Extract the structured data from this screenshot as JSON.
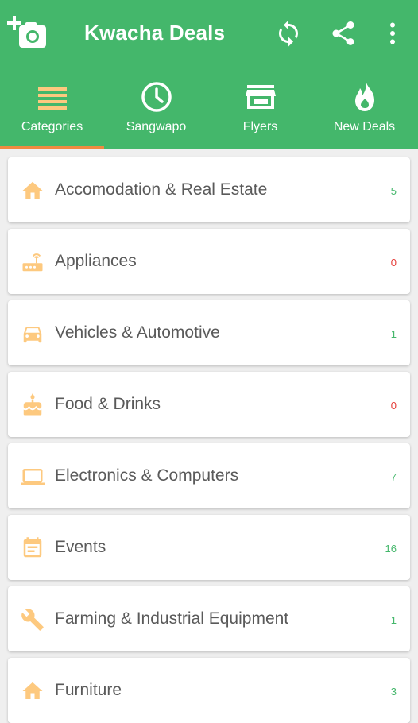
{
  "app": {
    "title": "Kwacha Deals",
    "brand_color": "#44b76b",
    "accent_color": "#f08a40",
    "icon_color": "#fdc97f"
  },
  "toolbar": {
    "actions": [
      "add-photo-icon",
      "refresh-icon",
      "share-icon",
      "more-vert-icon"
    ]
  },
  "tabs": [
    {
      "label": "Categories",
      "icon": "list-icon",
      "selected": true
    },
    {
      "label": "Sangwapo",
      "icon": "clock-icon",
      "selected": false
    },
    {
      "label": "Flyers",
      "icon": "store-icon",
      "selected": false
    },
    {
      "label": "New Deals",
      "icon": "flame-icon",
      "selected": false
    }
  ],
  "categories": [
    {
      "name": "Accomodation & Real Estate",
      "count": "5",
      "icon": "home-icon",
      "count_color": "#44b76b"
    },
    {
      "name": "Appliances",
      "count": "0",
      "icon": "router-icon",
      "count_color": "#e53935"
    },
    {
      "name": "Vehicles & Automotive",
      "count": "1",
      "icon": "car-icon",
      "count_color": "#44b76b"
    },
    {
      "name": "Food & Drinks",
      "count": "0",
      "icon": "cake-icon",
      "count_color": "#e53935"
    },
    {
      "name": "Electronics & Computers",
      "count": "7",
      "icon": "laptop-icon",
      "count_color": "#44b76b"
    },
    {
      "name": "Events",
      "count": "16",
      "icon": "calendar-icon",
      "count_color": "#44b76b"
    },
    {
      "name": "Farming & Industrial Equipment",
      "count": "1",
      "icon": "wrench-icon",
      "count_color": "#44b76b"
    },
    {
      "name": "Furniture",
      "count": "3",
      "icon": "home-icon",
      "count_color": "#44b76b"
    }
  ]
}
